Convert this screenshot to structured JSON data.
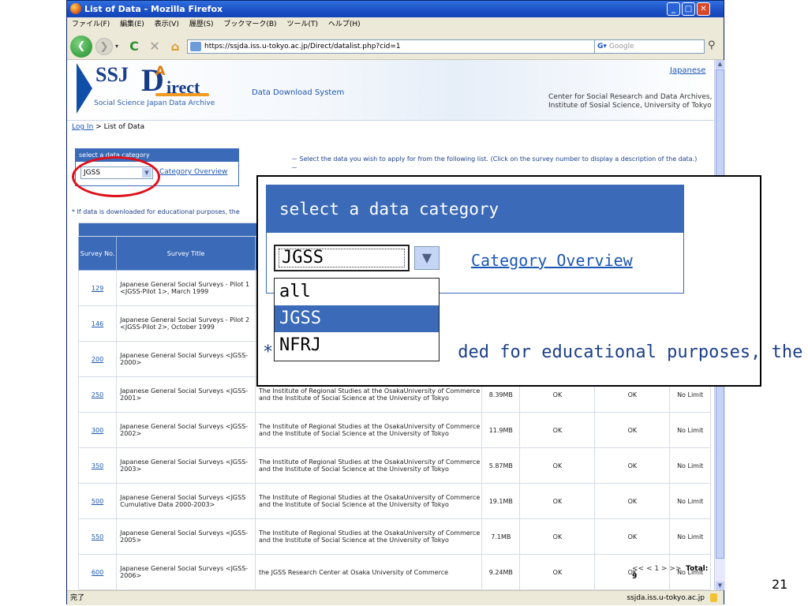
{
  "window": {
    "title": "List of Data - Mozilla Firefox"
  },
  "menu": [
    "ファイル(F)",
    "編集(E)",
    "表示(V)",
    "履歴(S)",
    "ブックマーク(B)",
    "ツール(T)",
    "ヘルプ(H)"
  ],
  "nav": {
    "url": "https://ssjda.iss.u-tokyo.ac.jp/Direct/datalist.php?cid=1",
    "search_placeholder": "Google"
  },
  "banner": {
    "ssj": "SSJ",
    "d": "D",
    "a": "A",
    "irect": "irect",
    "subtitle": "Social Science Japan Data Archive",
    "system": "Data Download System",
    "language_link": "Japanese",
    "center_line1": "Center for Social Research and Data Archives,",
    "center_line2": "Institute of Sosial Science, University of Tokyo"
  },
  "breadcrumb": {
    "login": "Log In",
    "sep": " > ",
    "current": "List of Data"
  },
  "category": {
    "header": "select a data category",
    "selected": "JGSS",
    "overview_link": "Category Overview",
    "options": [
      "all",
      "JGSS",
      "NFRJ"
    ]
  },
  "instructions": "－ Select the data you wish to apply for from the following list. (Click on the survey number to display a description of the data.) －",
  "note": "* If data is downloaded for educational purposes, the",
  "table": {
    "headers": {
      "no": "Survey No.",
      "title": "Survey Title"
    },
    "rows": [
      {
        "no": "129",
        "title": "Japanese General Social Surveys - Pilot 1 <JGSS-Pilot 1>, March 1999",
        "depositor": "",
        "size": "",
        "c1": "",
        "c2": "",
        "limit": ""
      },
      {
        "no": "146",
        "title": "Japanese General Social Surveys - Pilot 2 <JGSS-Pilot 2>, October 1999",
        "depositor": "",
        "size": "",
        "c1": "",
        "c2": "",
        "limit": ""
      },
      {
        "no": "200",
        "title": "Japanese General Social Surveys <JGSS-2000>",
        "depositor": "",
        "size": "",
        "c1": "",
        "c2": "",
        "limit": ""
      },
      {
        "no": "250",
        "title": "Japanese General Social Surveys <JGSS-2001>",
        "depositor": "The Institute of Regional Studies at the OsakaUniversity of Commerce and the Institute of Social Science at the University of Tokyo",
        "size": "8.39MB",
        "c1": "OK",
        "c2": "OK",
        "limit": "No Limit"
      },
      {
        "no": "300",
        "title": "Japanese General Social Surveys <JGSS-2002>",
        "depositor": "The Institute of Regional Studies at the OsakaUniversity of Commerce and the Institute of Social Science at the University of Tokyo",
        "size": "11.9MB",
        "c1": "OK",
        "c2": "OK",
        "limit": "No Limit"
      },
      {
        "no": "350",
        "title": "Japanese General Social Surveys <JGSS-2003>",
        "depositor": "The Institute of Regional Studies at the OsakaUniversity of Commerce and the Institute of Social Science at the University of Tokyo",
        "size": "5.87MB",
        "c1": "OK",
        "c2": "OK",
        "limit": "No Limit"
      },
      {
        "no": "500",
        "title": "Japanese General Social Surveys <JGSS Cumulative Data 2000-2003>",
        "depositor": "The Institute of Regional Studies at the OsakaUniversity of Commerce and the Institute of Social Science at the University of Tokyo",
        "size": "19.1MB",
        "c1": "OK",
        "c2": "OK",
        "limit": "No Limit"
      },
      {
        "no": "550",
        "title": "Japanese General Social Surveys <JGSS-2005>",
        "depositor": "The Institute of Regional Studies at the OsakaUniversity of Commerce and the Institute of Social Science at the University of Tokyo",
        "size": "7.1MB",
        "c1": "OK",
        "c2": "OK",
        "limit": "No Limit"
      },
      {
        "no": "600",
        "title": "Japanese General Social Surveys <JGSS-2006>",
        "depositor": "the JGSS Research Center at Osaka University of Commerce",
        "size": "9.24MB",
        "c1": "OK",
        "c2": "OK",
        "limit": "No Limit"
      }
    ]
  },
  "pager": {
    "nav": "<< < 1 > >>",
    "total": "Total: 9"
  },
  "status": {
    "left": "完了",
    "right": "ssjda.iss.u-tokyo.ac.jp"
  },
  "zoom": {
    "header": "select a data category",
    "selected": "JGSS",
    "overview_link": "Category Overview",
    "options": [
      "all",
      "JGSS",
      "NFRJ"
    ],
    "note_star": "*",
    "note_tail": "ded for educational purposes, the"
  },
  "slide_number": "21"
}
